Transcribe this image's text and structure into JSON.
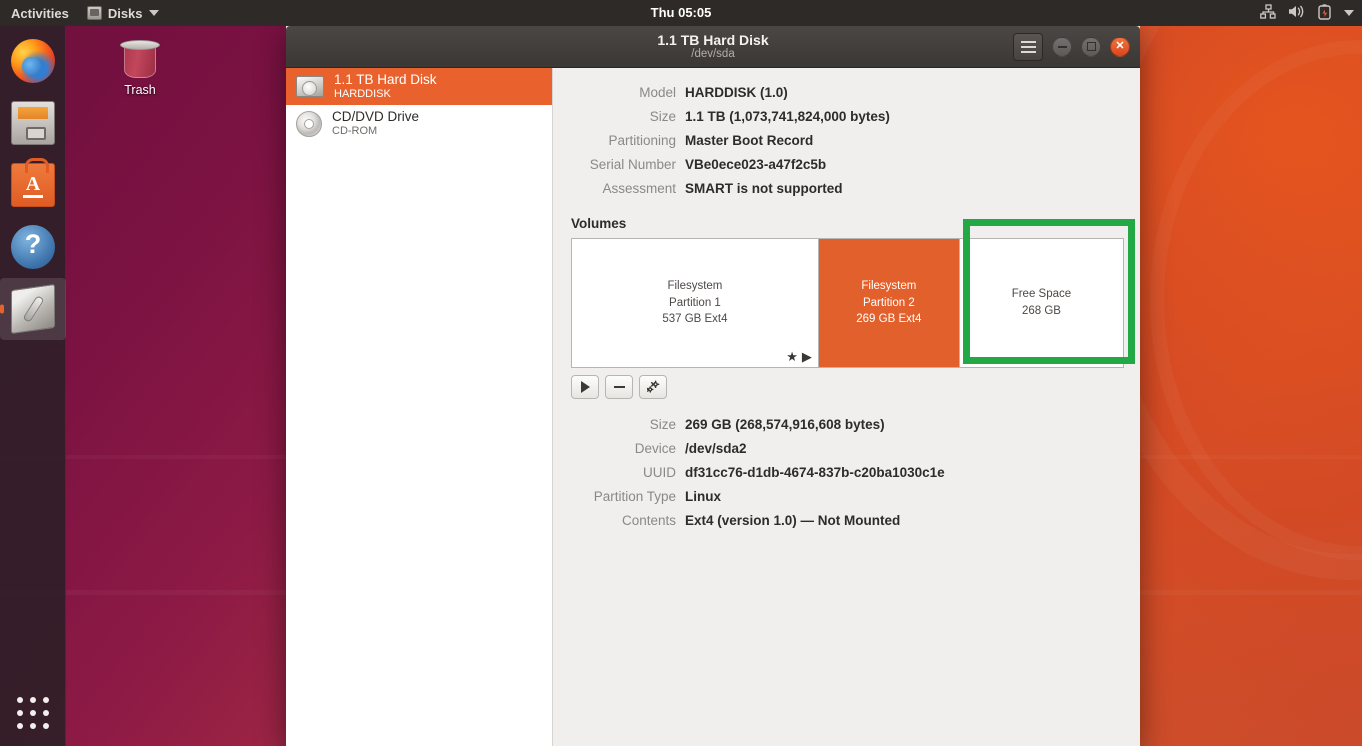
{
  "topbar": {
    "activities": "Activities",
    "app_name": "Disks",
    "app_icon": "disks-app-icon",
    "clock": "Thu 05:05",
    "tray_icons": [
      "network-icon",
      "volume-icon",
      "battery-icon",
      "system-menu-caret-icon"
    ]
  },
  "dock": {
    "items": [
      {
        "name": "firefox",
        "label": "Firefox Web Browser",
        "active": false
      },
      {
        "name": "files",
        "label": "Files",
        "active": false
      },
      {
        "name": "software",
        "label": "Ubuntu Software",
        "active": false
      },
      {
        "name": "help",
        "label": "Help",
        "active": false
      },
      {
        "name": "disks",
        "label": "Disks",
        "active": true
      }
    ],
    "show_apps_label": "Show Applications"
  },
  "desktop": {
    "trash_label": "Trash"
  },
  "window": {
    "title": "1.1 TB Hard Disk",
    "subtitle": "/dev/sda",
    "menu_icon": "hamburger-menu-icon",
    "minimize_icon": "minimize-icon",
    "maximize_icon": "maximize-icon",
    "close_icon": "close-icon"
  },
  "sidebar": {
    "devices": [
      {
        "title": "1.1 TB Hard Disk",
        "subtitle": "HARDDISK",
        "icon": "hard-disk-icon",
        "selected": true
      },
      {
        "title": "CD/DVD Drive",
        "subtitle": "CD-ROM",
        "icon": "cd-rom-icon",
        "selected": false
      }
    ]
  },
  "drive_info": {
    "rows": [
      {
        "key": "Model",
        "value": "HARDDISK (1.0)"
      },
      {
        "key": "Size",
        "value": "1.1 TB (1,073,741,824,000 bytes)"
      },
      {
        "key": "Partitioning",
        "value": "Master Boot Record"
      },
      {
        "key": "Serial Number",
        "value": "VBe0ece023-a47f2c5b"
      },
      {
        "key": "Assessment",
        "value": "SMART is not supported"
      }
    ]
  },
  "volumes": {
    "heading": "Volumes",
    "partitions": [
      {
        "lines": [
          "Filesystem",
          "Partition 1",
          "537 GB Ext4"
        ],
        "selected": false,
        "width_pct": 44.8,
        "badges": [
          "star-icon",
          "play-triangle-icon"
        ]
      },
      {
        "lines": [
          "Filesystem",
          "Partition 2",
          "269 GB Ext4"
        ],
        "selected": true,
        "width_pct": 25.6,
        "badges": []
      },
      {
        "lines": [
          "Free Space",
          "268 GB"
        ],
        "selected": false,
        "width_pct": 29.6,
        "badges": []
      }
    ],
    "toolbar": [
      {
        "name": "mount-volume-button",
        "icon": "play-icon",
        "label": "Mount selected partition"
      },
      {
        "name": "delete-partition-button",
        "icon": "minus-icon",
        "label": "Delete selected partition"
      },
      {
        "name": "more-actions-button",
        "icon": "gears-icon",
        "label": "More actions"
      }
    ]
  },
  "partition_details": {
    "rows": [
      {
        "key": "Size",
        "value": "269 GB (268,574,916,608 bytes)"
      },
      {
        "key": "Device",
        "value": "/dev/sda2"
      },
      {
        "key": "UUID",
        "value": "df31cc76-d1db-4674-837b-c20ba1030c1e"
      },
      {
        "key": "Partition Type",
        "value": "Linux"
      },
      {
        "key": "Contents",
        "value": "Ext4 (version 1.0) — Not Mounted"
      }
    ]
  },
  "annotation": {
    "highlight_color": "#22a844",
    "highlight_target": "free-space-partition"
  },
  "colors": {
    "accent_orange": "#e9622d",
    "selected_partition": "#e2602c",
    "titlebar": "#3b3735",
    "content_bg": "#f0efee"
  }
}
